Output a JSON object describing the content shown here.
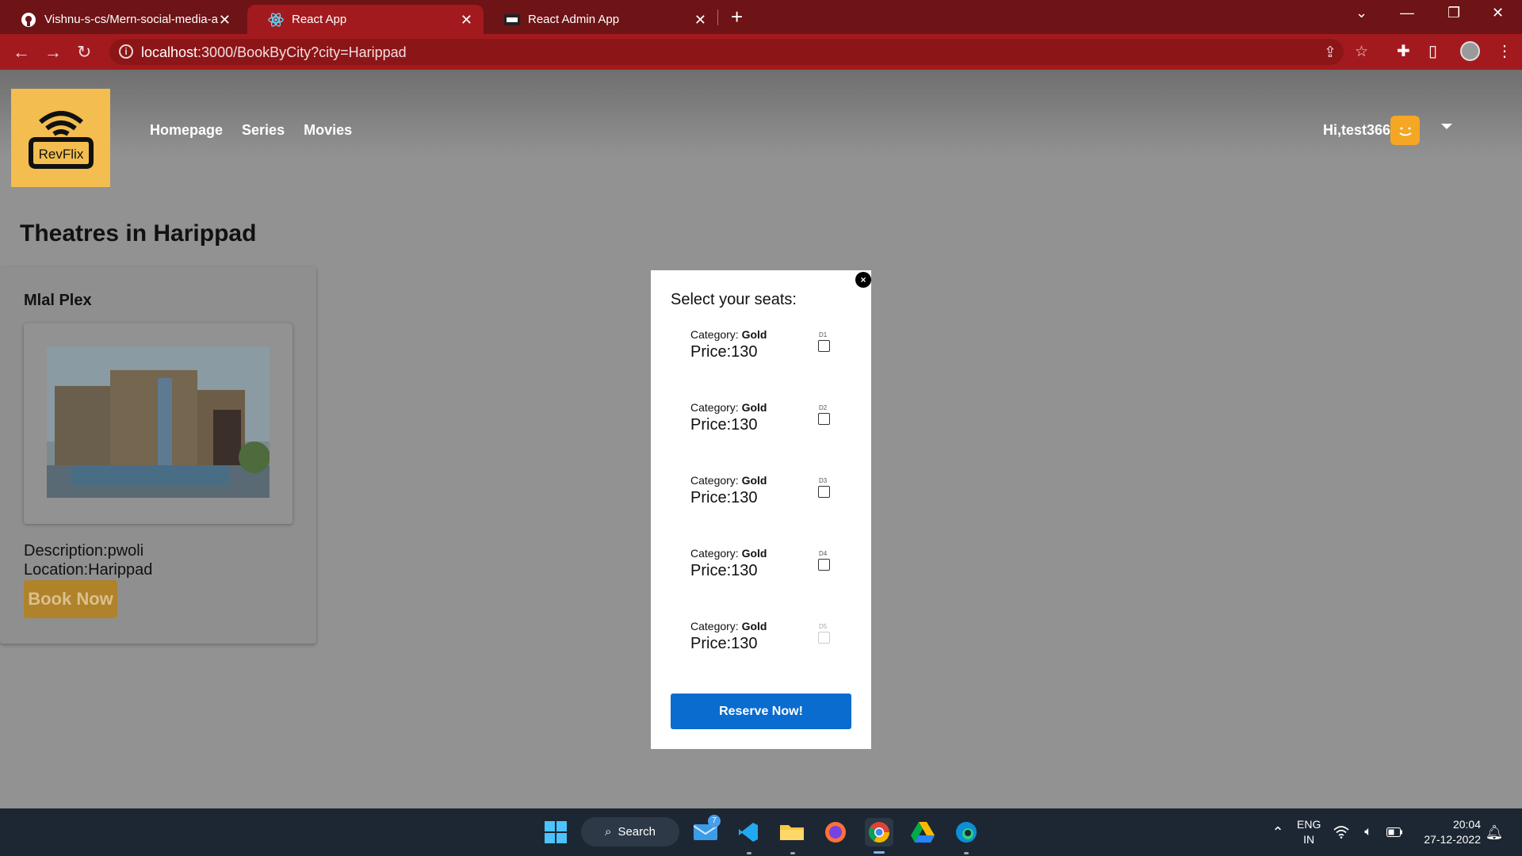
{
  "browser": {
    "tabs": [
      {
        "title": "Vishnu-s-cs/Mern-social-media-a",
        "icon": "github-icon"
      },
      {
        "title": "React App",
        "icon": "react-icon",
        "active": true
      },
      {
        "title": "React Admin App",
        "icon": "app-icon"
      }
    ],
    "url_host": "localhost",
    "url_rest": ":3000/BookByCity?city=Harippad"
  },
  "nav": {
    "logo_text": "RevFlix",
    "links": [
      "Homepage",
      "Series",
      "Movies"
    ],
    "user_greeting": "Hi,test366"
  },
  "main": {
    "title": "Theatres in Harippad",
    "theatre": {
      "name": "Mlal Plex",
      "description": "Description:pwoli",
      "location": "Location:Harippad",
      "book_label": "Book Now"
    }
  },
  "modal": {
    "title": "Select your seats:",
    "category_label": "Category: ",
    "seats": [
      {
        "id": "D1",
        "category": "Gold",
        "price": "Price:130",
        "disabled": false
      },
      {
        "id": "D2",
        "category": "Gold",
        "price": "Price:130",
        "disabled": false
      },
      {
        "id": "D3",
        "category": "Gold",
        "price": "Price:130",
        "disabled": false
      },
      {
        "id": "D4",
        "category": "Gold",
        "price": "Price:130",
        "disabled": false
      },
      {
        "id": "D5",
        "category": "Gold",
        "price": "Price:130",
        "disabled": true
      }
    ],
    "reserve_label": "Reserve Now!",
    "close_label": "×"
  },
  "taskbar": {
    "search_label": "Search",
    "mail_badge": "7",
    "lang_top": "ENG",
    "lang_bottom": "IN",
    "time": "20:04",
    "date": "27-12-2022"
  },
  "colors": {
    "brand_yellow": "#f3bd4f",
    "book_button": "#b0822a",
    "reserve_button": "#0a6ccf",
    "browser_chrome": "#a31a1e"
  }
}
